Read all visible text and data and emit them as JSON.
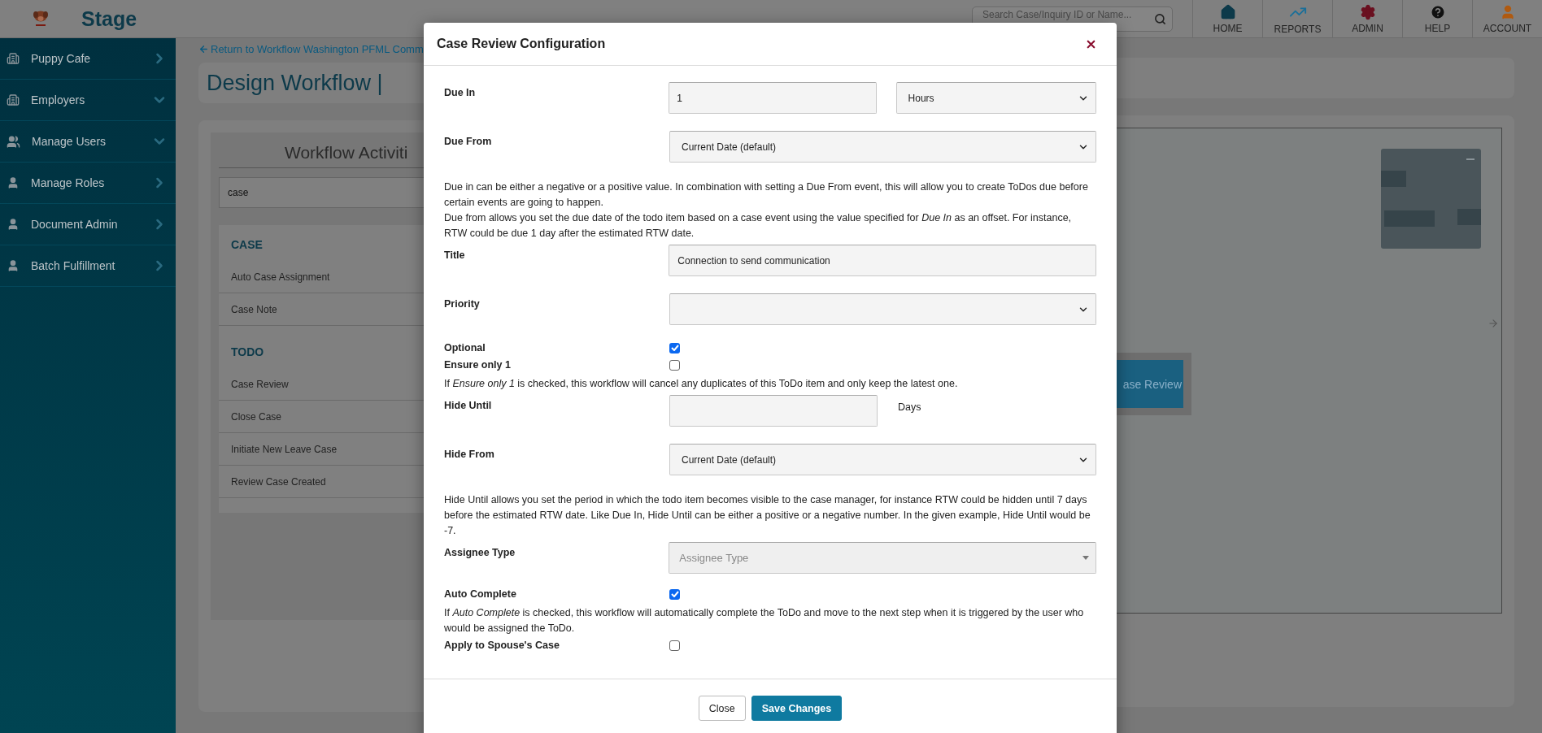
{
  "header": {
    "brand": "Stage",
    "search": {
      "placeholder": "Search Case/Inquiry ID or Name..."
    },
    "nav": [
      {
        "label": "HOME"
      },
      {
        "label": "REPORTS"
      },
      {
        "label": "ADMIN"
      },
      {
        "label": "HELP"
      },
      {
        "label": "ACCOUNT"
      }
    ]
  },
  "sidebar": {
    "items": [
      {
        "label": "Puppy Cafe",
        "expanded": false
      },
      {
        "label": "Employers",
        "expanded": true
      },
      {
        "label": "Manage Users",
        "expanded": true
      },
      {
        "label": "Manage Roles",
        "expanded": false
      },
      {
        "label": "Document Admin",
        "expanded": false
      },
      {
        "label": "Batch Fulfillment",
        "expanded": false
      }
    ]
  },
  "page": {
    "back_link": "Return to Workflow Washington PFML Comm",
    "title": "Design Workflow |",
    "activities": {
      "heading": "Workflow Activiti",
      "search": {
        "value": "case"
      },
      "groups": [
        {
          "title": "CASE",
          "items": [
            "Auto Case Assignment",
            "Case Note"
          ]
        },
        {
          "title": "TODO",
          "items": [
            "Case Review",
            "Close Case",
            "Initiate New Leave Case",
            "Review Case Created"
          ]
        }
      ]
    },
    "canvas": {
      "node": "ase Review"
    }
  },
  "modal": {
    "title": "Case Review Configuration",
    "rows": [
      {
        "kind": "input_select",
        "label": "Due In",
        "value": "1",
        "option": "Hours"
      },
      {
        "kind": "select",
        "label": "Due From",
        "value": "Current Date (default)"
      },
      {
        "kind": "help",
        "text": "Due in can be either a negative or a positive value. In combination with setting a Due From event, this will allow you to create ToDos due before certain events are going to happen."
      },
      {
        "kind": "help",
        "text": "Due from allows you set the due date of the todo item based on a case event using the value specified for *Due In* as an offset. For instance, RTW could be due 1 day after the estimated RTW date."
      },
      {
        "kind": "input",
        "label": "Title",
        "value": "Connection to send communication"
      },
      {
        "kind": "select",
        "label": "Priority"
      },
      {
        "kind": "checkbox",
        "label": "Optional",
        "checked": true
      },
      {
        "kind": "checkbox",
        "label": "Ensure only 1",
        "checked": false
      },
      {
        "kind": "help",
        "text": "If *Ensure only 1* is checked, this workflow will cancel any duplicates of this ToDo item and only keep the latest one."
      },
      {
        "kind": "input_suffix",
        "label": "Hide Until",
        "suffix": "Days"
      },
      {
        "kind": "select",
        "label": "Hide From",
        "value": "Current Date (default)"
      },
      {
        "kind": "help",
        "text": "Hide Until allows you set the period in which the todo item becomes visible to the case manager, for instance RTW could be hidden until 7 days before the estimated RTW date. Like Due In, Hide Until can be either a positive or a negative number. In the given example, Hide Until would be -7."
      },
      {
        "kind": "combo",
        "label": "Assignee Type",
        "placeholder": "Assignee Type"
      },
      {
        "kind": "checkbox",
        "label": "Auto Complete",
        "checked": true
      },
      {
        "kind": "help",
        "text": "If *Auto Complete* is checked, this workflow will automatically complete the ToDo and move to the next step when it is triggered by the user who would be assigned the ToDo."
      },
      {
        "kind": "checkbox",
        "label": "Apply to Spouse's Case",
        "checked": false
      }
    ],
    "buttons": [
      {
        "label": "Close",
        "kind": "secondary"
      },
      {
        "label": "Save Changes",
        "kind": "primary"
      }
    ]
  }
}
